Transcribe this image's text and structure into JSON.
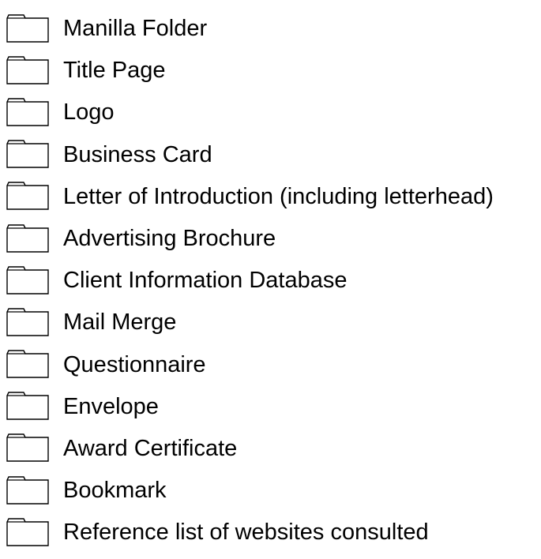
{
  "checklist": {
    "icon": "folder-checkbox-icon",
    "items": [
      {
        "label": "Manilla Folder"
      },
      {
        "label": "Title Page"
      },
      {
        "label": "Logo"
      },
      {
        "label": "Business Card"
      },
      {
        "label": "Letter of Introduction (including letterhead)"
      },
      {
        "label": "Advertising Brochure"
      },
      {
        "label": "Client Information Database"
      },
      {
        "label": "Mail Merge"
      },
      {
        "label": "Questionnaire"
      },
      {
        "label": "Envelope"
      },
      {
        "label": "Award Certificate"
      },
      {
        "label": "Bookmark"
      },
      {
        "label": "Reference list of websites consulted"
      }
    ]
  }
}
